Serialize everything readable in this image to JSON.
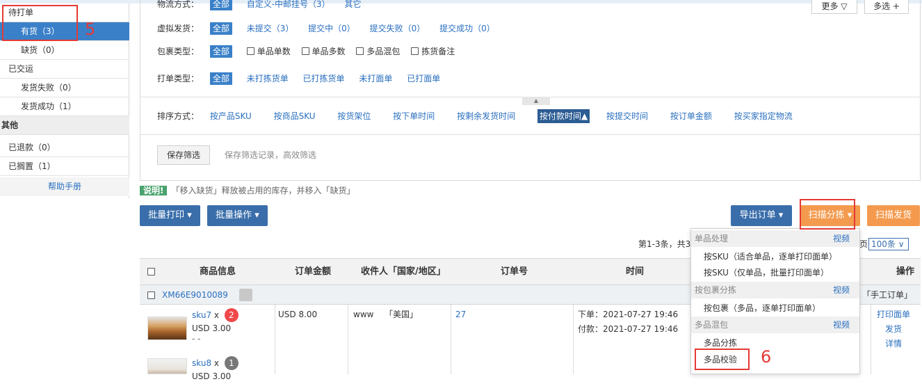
{
  "sidebar": {
    "pending_group": "待打单",
    "in_stock": "有货（3）",
    "out_of_stock": "缺货（0）",
    "shipped_group": "已交运",
    "ship_failed": "发货失败（0）",
    "ship_success": "发货成功（1）",
    "other_group": "其他",
    "refunded": "已退款（0）",
    "on_hold": "已搁置（1）",
    "help": "帮助手册"
  },
  "filters": {
    "row1_label": "物流方式：",
    "row1_all": "全部",
    "row1_items": [
      "自定义-中邮挂号（3）",
      "其它"
    ],
    "more_btn": "更多 ▽",
    "multi_btn": "多选 +",
    "virtual_label": "虚拟发货：",
    "virtual_all": "全部",
    "virtual_items": [
      "未提交（3）",
      "提交中（0）",
      "提交失败（0）",
      "提交成功（0）"
    ],
    "package_label": "包裹类型：",
    "package_all": "全部",
    "package_items": [
      "单品单数",
      "单品多数",
      "多品混包",
      "拣货备注"
    ],
    "print_label": "打单类型：",
    "print_all": "全部",
    "print_items": [
      "未打拣货单",
      "已打拣货单",
      "未打面单",
      "已打面单"
    ],
    "sort_label": "排序方式：",
    "sort_items": [
      "按产品SKU",
      "按商品SKU",
      "按货架位",
      "按下单时间",
      "按剩余发货时间"
    ],
    "sort_active": "按付款时间▲",
    "sort_items_after": [
      "按提交时间",
      "按订单金额",
      "按买家指定物流"
    ],
    "save_btn": "保存筛选",
    "save_tip": "保存筛选记录，高效筛选"
  },
  "notice": {
    "badge": "说明!",
    "text": "「移入缺货」释放被占用的库存，并移入「缺货」"
  },
  "toolbar": {
    "batch_print": "批量打印 ▾",
    "batch_ops": "批量操作 ▾",
    "export": "导出订单 ▾",
    "scan_sort": "扫描分拣 ▾",
    "scan_ship": "扫描发货"
  },
  "pager": {
    "text": "第1-3条，共3",
    "page_suffix": "页",
    "per_page": "100条 ∨"
  },
  "table": {
    "headers": [
      "商品信息",
      "订单金额",
      "收件人「国家/地区」",
      "订单号",
      "时间",
      "操作"
    ],
    "group_id": "XM66E9010089",
    "group_tag": "「手工订单」",
    "sku1": "sku7",
    "sku1_x": "x",
    "sku1_qty": "2",
    "sku1_price": "USD 3.00",
    "sku1_dash": "- -",
    "sku2": "sku8",
    "sku2_x": "x",
    "sku2_qty": "1",
    "sku2_price": "USD 3.00",
    "amount": "USD 8.00",
    "recipient": "www",
    "country": "「美国」",
    "order_no": "27",
    "order_time": "下单：2021-07-27 19:46",
    "pay_time": "付款：2021-07-27 19:46",
    "actions": [
      "打印面单",
      "发货",
      "详情"
    ]
  },
  "dropdown": {
    "sec1": "单品处理",
    "sec1_video": "视频",
    "item1": "按SKU（适合单品，逐单打印面单）",
    "item2": "按SKU（仅单品，批量打印面单）",
    "sec2": "按包裹分拣",
    "sec2_video": "视频",
    "item3": "按包裹（多品，逐单打印面单）",
    "sec3": "多品混包",
    "sec3_video": "视频",
    "item4": "多品分拣",
    "item5": "多品校验"
  },
  "annotations": {
    "num5": "5",
    "num6": "6"
  },
  "colors": {
    "accent_blue": "#3a6eaa",
    "selected_blue": "#3a80c8",
    "orange": "#f49a4e",
    "annotation_red": "#e53935",
    "link": "#2a6fbf"
  }
}
